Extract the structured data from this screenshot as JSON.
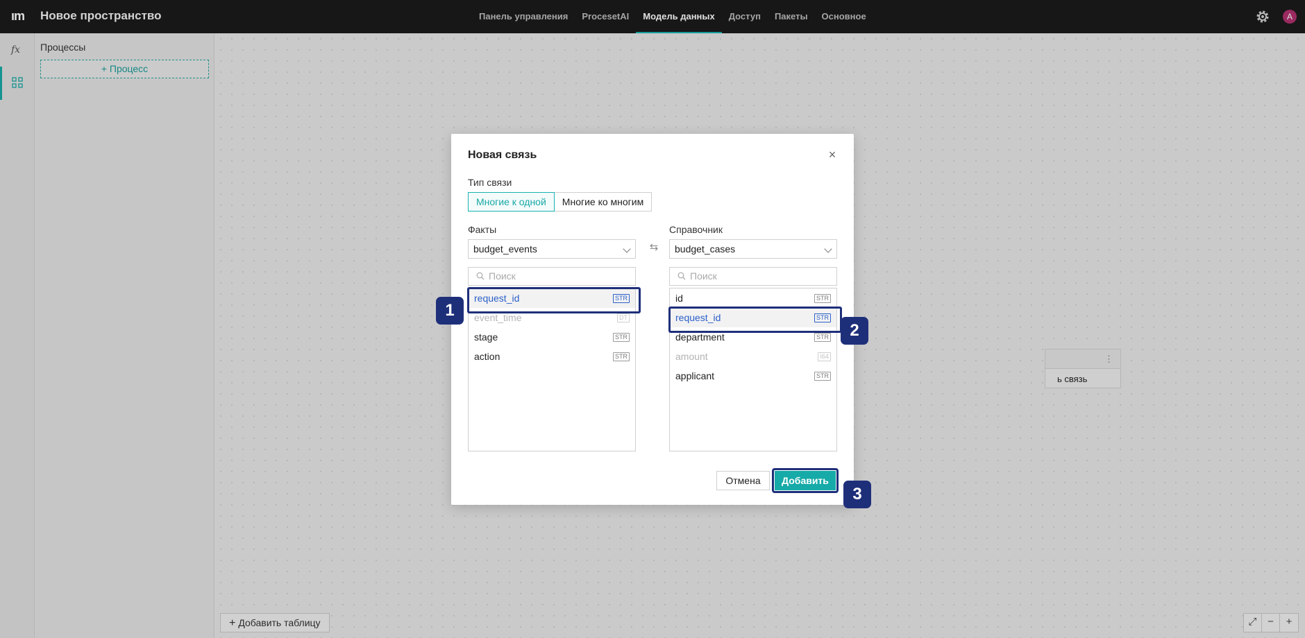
{
  "topbar": {
    "logo": "ım",
    "title": "Новое пространство",
    "nav": [
      {
        "label": "Панель управления"
      },
      {
        "label": "ProcesetAI"
      },
      {
        "label": "Модель данных",
        "active": true
      },
      {
        "label": "Доступ"
      },
      {
        "label": "Пакеты"
      },
      {
        "label": "Основное"
      }
    ],
    "avatar": "A",
    "accent": "#17b3b0"
  },
  "rail": {
    "fx_label": "fx"
  },
  "panel": {
    "title": "Процессы",
    "add_process": "+ Процесс"
  },
  "canvas": {
    "node_text": "ь связь",
    "add_table": "Добавить таблицу",
    "zoom": [
      "⤢",
      "−",
      "+"
    ]
  },
  "modal": {
    "title": "Новая связь",
    "close": "×",
    "type_label": "Тип связи",
    "types": [
      "Многие к одной",
      "Многие ко многим"
    ],
    "selected_type": "Многие к одной",
    "left": {
      "label": "Факты",
      "table": "budget_events",
      "search_placeholder": "Поиск",
      "fields": [
        {
          "name": "request_id",
          "type": "STR"
        },
        {
          "name": "event_time",
          "type": "DT"
        },
        {
          "name": "stage",
          "type": "STR"
        },
        {
          "name": "action",
          "type": "STR"
        }
      ]
    },
    "right": {
      "label": "Справочник",
      "table": "budget_cases",
      "search_placeholder": "Поиск",
      "fields": [
        {
          "name": "id",
          "type": "STR"
        },
        {
          "name": "request_id",
          "type": "STR"
        },
        {
          "name": "department",
          "type": "STR"
        },
        {
          "name": "amount",
          "type": "I64"
        },
        {
          "name": "applicant",
          "type": "STR"
        }
      ]
    },
    "cancel": "Отмена",
    "add": "Добавить"
  },
  "steps": [
    "1",
    "2",
    "3"
  ]
}
